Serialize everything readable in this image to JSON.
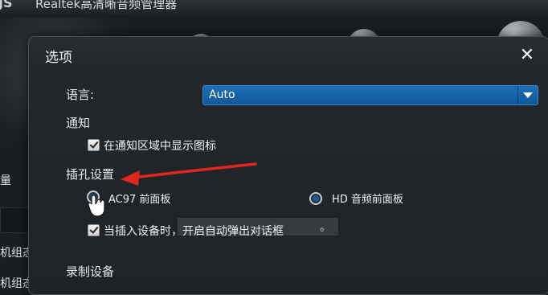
{
  "background": {
    "logo": "JS",
    "app_title": "Realtek高清晰音频管理器",
    "side_labels": [
      "量",
      "机组态",
      "机组态"
    ]
  },
  "dialog": {
    "title": "选项",
    "close_glyph": "✕",
    "language": {
      "label": "语言:",
      "value": "Auto"
    },
    "notify": {
      "label": "通知",
      "checkbox_label": "在通知区域中显示图标",
      "checked": true
    },
    "jack": {
      "label": "插孔设置",
      "radio_options": [
        {
          "label": "AC97 前面板",
          "selected": false
        },
        {
          "label": "HD 音频前面板",
          "selected": true
        }
      ],
      "popup_checkbox_label": "当插入设备时，开启自动弹出对话框",
      "popup_checkbox_trailing": "。",
      "popup_checked": true
    },
    "record_label": "录制设备"
  },
  "colors": {
    "accent": "#1a65ab",
    "annotation_arrow": "#e0261e",
    "dialog_bg": "#23272a"
  }
}
